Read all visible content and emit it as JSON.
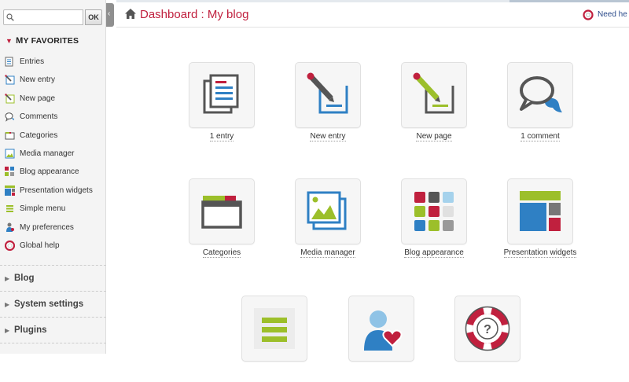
{
  "search": {
    "placeholder": "",
    "ok_label": "OK"
  },
  "favorites": {
    "heading_first": "M",
    "heading_rest": "Y FAVORITES",
    "items": [
      {
        "label": "Entries",
        "icon": "entries-icon"
      },
      {
        "label": "New entry",
        "icon": "new-entry-icon"
      },
      {
        "label": "New page",
        "icon": "new-page-icon"
      },
      {
        "label": "Comments",
        "icon": "comments-icon"
      },
      {
        "label": "Categories",
        "icon": "categories-icon"
      },
      {
        "label": "Media manager",
        "icon": "media-icon"
      },
      {
        "label": "Blog appearance",
        "icon": "appearance-icon"
      },
      {
        "label": "Presentation widgets",
        "icon": "widgets-icon"
      },
      {
        "label": "Simple menu",
        "icon": "menu-icon"
      },
      {
        "label": "My preferences",
        "icon": "preferences-icon"
      },
      {
        "label": "Global help",
        "icon": "help-icon"
      }
    ]
  },
  "sections": [
    {
      "label": "Blog"
    },
    {
      "label": "System settings"
    },
    {
      "label": "Plugins"
    }
  ],
  "header": {
    "title": "Dashboard : My blog",
    "help_label": "Need he"
  },
  "tiles": [
    {
      "label": "1 entry"
    },
    {
      "label": "New entry"
    },
    {
      "label": "New page"
    },
    {
      "label": "1 comment"
    },
    {
      "label": "Categories"
    },
    {
      "label": "Media manager"
    },
    {
      "label": "Blog appearance"
    },
    {
      "label": "Presentation widgets"
    },
    {
      "label": ""
    },
    {
      "label": ""
    },
    {
      "label": ""
    }
  ],
  "colors": {
    "accent_red": "#c0203e",
    "blue": "#2f80c4",
    "green": "#9cbf2a",
    "dark_gray": "#555555"
  }
}
